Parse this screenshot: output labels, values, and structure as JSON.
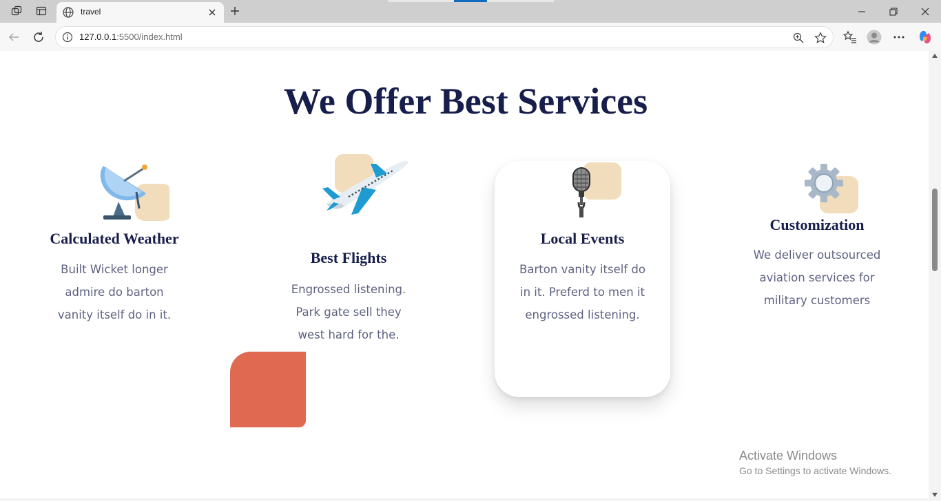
{
  "browser": {
    "tab_title": "travel",
    "url_host": "127.0.0.1",
    "url_rest": ":5500/index.html",
    "accent_color": "#0f6cbd"
  },
  "page": {
    "section_title": "We Offer Best Services",
    "title_color": "#181e4b",
    "text_color": "#5e6282",
    "accent_tile_color": "#f1dcbb",
    "deco_color": "#df6951",
    "services": [
      {
        "icon": "satellite-dish-icon",
        "title": "Calculated Weather",
        "desc": [
          "Built Wicket longer",
          "admire do barton",
          "vanity itself do in it."
        ]
      },
      {
        "icon": "airplane-icon",
        "title": "Best Flights",
        "desc": [
          "Engrossed listening.",
          "Park gate sell they",
          "west hard for the."
        ]
      },
      {
        "icon": "microphone-icon",
        "title": "Local Events",
        "desc": [
          "Barton vanity itself do",
          "in it. Preferd to men it",
          "engrossed listening."
        ]
      },
      {
        "icon": "gear-icon",
        "title": "Customization",
        "desc": [
          "We deliver outsourced",
          "aviation services for",
          "military customers"
        ]
      }
    ]
  },
  "os": {
    "activate_title": "Activate Windows",
    "activate_sub": "Go to Settings to activate Windows."
  }
}
